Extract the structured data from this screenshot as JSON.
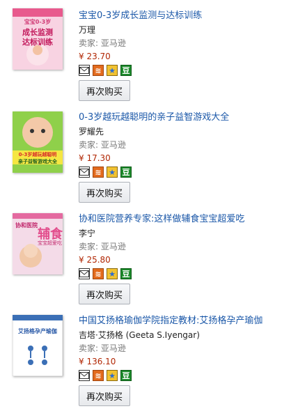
{
  "items": [
    {
      "title": "宝宝0-3岁成长监测与达标训练",
      "author": "万理",
      "seller": "卖家: 亚马逊",
      "price": "¥ 23.70",
      "button": "再次购买",
      "cover_text": [
        "宝宝0-3岁",
        "成长监测",
        "达标训练"
      ]
    },
    {
      "title": "0-3岁越玩越聪明的亲子益智游戏大全",
      "author": "罗耀先",
      "seller": "卖家: 亚马逊",
      "price": "¥ 17.30",
      "button": "再次购买",
      "cover_text": [
        "0-3岁越玩越聪明",
        "亲子益智游戏大全"
      ]
    },
    {
      "title": "协和医院营养专家:这样做辅食宝宝超爱吃",
      "author": "李宁",
      "seller": "卖家: 亚马逊",
      "price": "¥ 25.80",
      "button": "再次购买",
      "cover_text": [
        "协和医院",
        "辅食",
        "宝宝超爱吃"
      ]
    },
    {
      "title": "中国艾扬格瑜伽学院指定教材:艾扬格孕产瑜伽",
      "author": "吉塔·艾扬格 (Geeta S.Iyengar)",
      "seller": "卖家: 亚马逊",
      "price": "¥ 136.10",
      "button": "再次购买",
      "cover_text": [
        "艾扬格孕产瑜伽"
      ]
    }
  ],
  "share_icons": [
    "mail-icon",
    "rss-icon",
    "star-icon",
    "douban-icon"
  ],
  "share_glyphs": {
    "rss": "≋",
    "star": "★",
    "dou": "豆"
  },
  "colors": {
    "title": "#1a57a8",
    "price": "#b12704",
    "seller": "#777777"
  }
}
